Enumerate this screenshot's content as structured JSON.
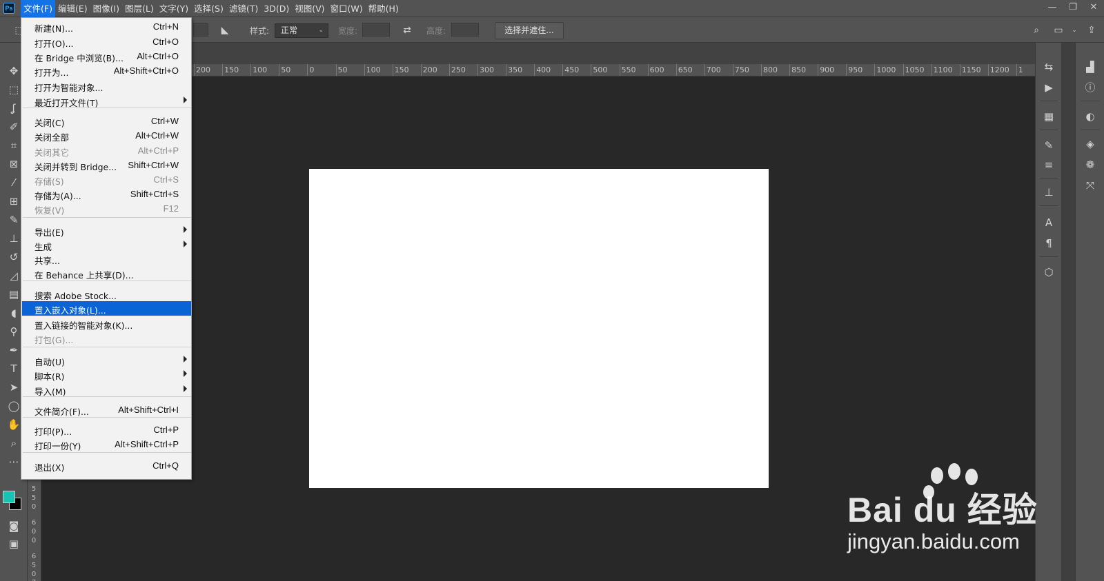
{
  "app": {
    "logo_text": "Ps"
  },
  "menubar": {
    "items": [
      "文件(F)",
      "编辑(E)",
      "图像(I)",
      "图层(L)",
      "文字(Y)",
      "选择(S)",
      "滤镜(T)",
      "3D(D)",
      "视图(V)",
      "窗口(W)",
      "帮助(H)"
    ],
    "active_index": 0
  },
  "window_controls": {
    "minimize": "—",
    "restore": "❐",
    "close": "✕"
  },
  "options_bar": {
    "style_label": "样式:",
    "style_value": "正常",
    "width_label": "宽度:",
    "height_label": "高度:",
    "select_mask_label": "选择并遮住..."
  },
  "ruler_top": {
    "ticks": [
      "200",
      "150",
      "100",
      "50",
      "0",
      "50",
      "100",
      "150",
      "200",
      "250",
      "300",
      "350",
      "400",
      "450",
      "500",
      "550",
      "600",
      "650",
      "700",
      "750",
      "800",
      "850",
      "900",
      "950",
      "1000",
      "1050",
      "1100",
      "1150",
      "1200",
      "1"
    ]
  },
  "ruler_left": {
    "digits": [
      "5",
      "5",
      "0",
      "6",
      "0",
      "0",
      "6",
      "5",
      "0",
      "7"
    ]
  },
  "file_menu": {
    "items": [
      {
        "label": "新建(N)...",
        "shortcut": "Ctrl+N",
        "disabled": false
      },
      {
        "label": "打开(O)...",
        "shortcut": "Ctrl+O",
        "disabled": false
      },
      {
        "label": "在 Bridge 中浏览(B)...",
        "shortcut": "Alt+Ctrl+O",
        "disabled": false
      },
      {
        "label": "打开为...",
        "shortcut": "Alt+Shift+Ctrl+O",
        "disabled": false
      },
      {
        "label": "打开为智能对象...",
        "shortcut": "",
        "disabled": false
      },
      {
        "label": "最近打开文件(T)",
        "shortcut": "",
        "submenu": true,
        "disabled": false
      },
      {
        "label": "关闭(C)",
        "shortcut": "Ctrl+W",
        "disabled": false
      },
      {
        "label": "关闭全部",
        "shortcut": "Alt+Ctrl+W",
        "disabled": false
      },
      {
        "label": "关闭其它",
        "shortcut": "Alt+Ctrl+P",
        "disabled": true
      },
      {
        "label": "关闭并转到 Bridge...",
        "shortcut": "Shift+Ctrl+W",
        "disabled": false
      },
      {
        "label": "存储(S)",
        "shortcut": "Ctrl+S",
        "disabled": true
      },
      {
        "label": "存储为(A)...",
        "shortcut": "Shift+Ctrl+S",
        "disabled": false
      },
      {
        "label": "恢复(V)",
        "shortcut": "F12",
        "disabled": true
      },
      {
        "label": "导出(E)",
        "shortcut": "",
        "submenu": true,
        "disabled": false
      },
      {
        "label": "生成",
        "shortcut": "",
        "submenu": true,
        "disabled": false
      },
      {
        "label": "共享...",
        "shortcut": "",
        "disabled": false
      },
      {
        "label": "在 Behance 上共享(D)...",
        "shortcut": "",
        "disabled": false
      },
      {
        "label": "搜索 Adobe Stock...",
        "shortcut": "",
        "disabled": false
      },
      {
        "label": "置入嵌入对象(L)...",
        "shortcut": "",
        "disabled": false,
        "highlighted": true
      },
      {
        "label": "置入链接的智能对象(K)...",
        "shortcut": "",
        "disabled": false
      },
      {
        "label": "打包(G)...",
        "shortcut": "",
        "disabled": true
      },
      {
        "label": "自动(U)",
        "shortcut": "",
        "submenu": true,
        "disabled": false
      },
      {
        "label": "脚本(R)",
        "shortcut": "",
        "submenu": true,
        "disabled": false
      },
      {
        "label": "导入(M)",
        "shortcut": "",
        "submenu": true,
        "disabled": false
      },
      {
        "label": "文件简介(F)...",
        "shortcut": "Alt+Shift+Ctrl+I",
        "disabled": false
      },
      {
        "label": "打印(P)...",
        "shortcut": "Ctrl+P",
        "disabled": false
      },
      {
        "label": "打印一份(Y)",
        "shortcut": "Alt+Shift+Ctrl+P",
        "disabled": false
      },
      {
        "label": "退出(X)",
        "shortcut": "Ctrl+Q",
        "disabled": false
      }
    ]
  },
  "colors": {
    "foreground": "#18c3b4",
    "background": "#000000",
    "menu_highlight": "#0a64d6",
    "canvas": "#ffffff"
  },
  "watermark": {
    "logo": "Bai du 经验",
    "url": "jingyan.baidu.com"
  },
  "tools": [
    "move-icon",
    "marquee-icon",
    "lasso-icon",
    "quick-select-icon",
    "crop-icon",
    "frame-icon",
    "eyedropper-icon",
    "patch-icon",
    "brush-icon",
    "stamp-icon",
    "history-brush-icon",
    "eraser-icon",
    "gradient-icon",
    "blur-icon",
    "dodge-icon",
    "pen-icon",
    "type-icon",
    "path-select-icon",
    "ellipse-icon",
    "hand-icon",
    "zoom-icon",
    "more-icon"
  ]
}
